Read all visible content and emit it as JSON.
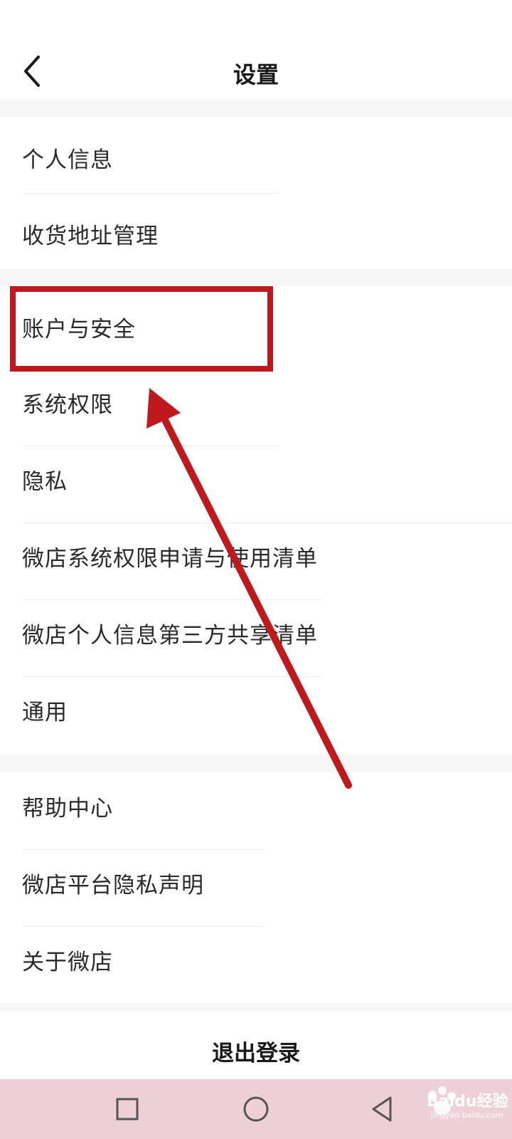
{
  "header": {
    "title": "设置"
  },
  "groups": [
    [
      "个人信息",
      "收货地址管理"
    ],
    [
      "账户与安全",
      "系统权限",
      "隐私",
      "微店系统权限申请与使用清单",
      "微店个人信息第三方共享清单",
      "通用"
    ],
    [
      "帮助中心",
      "微店平台隐私声明",
      "关于微店"
    ]
  ],
  "logout_label": "退出登录",
  "annotation": {
    "highlight_color": "#c0191d",
    "highlighted_item": "账户与安全"
  },
  "watermark": {
    "text": "Baidu经验",
    "sub": "jingyan.baidu.com"
  },
  "colors": {
    "nav_bg": "#eed1d6",
    "text": "#2a2a2a",
    "gap_bg": "#f7f7f7"
  }
}
